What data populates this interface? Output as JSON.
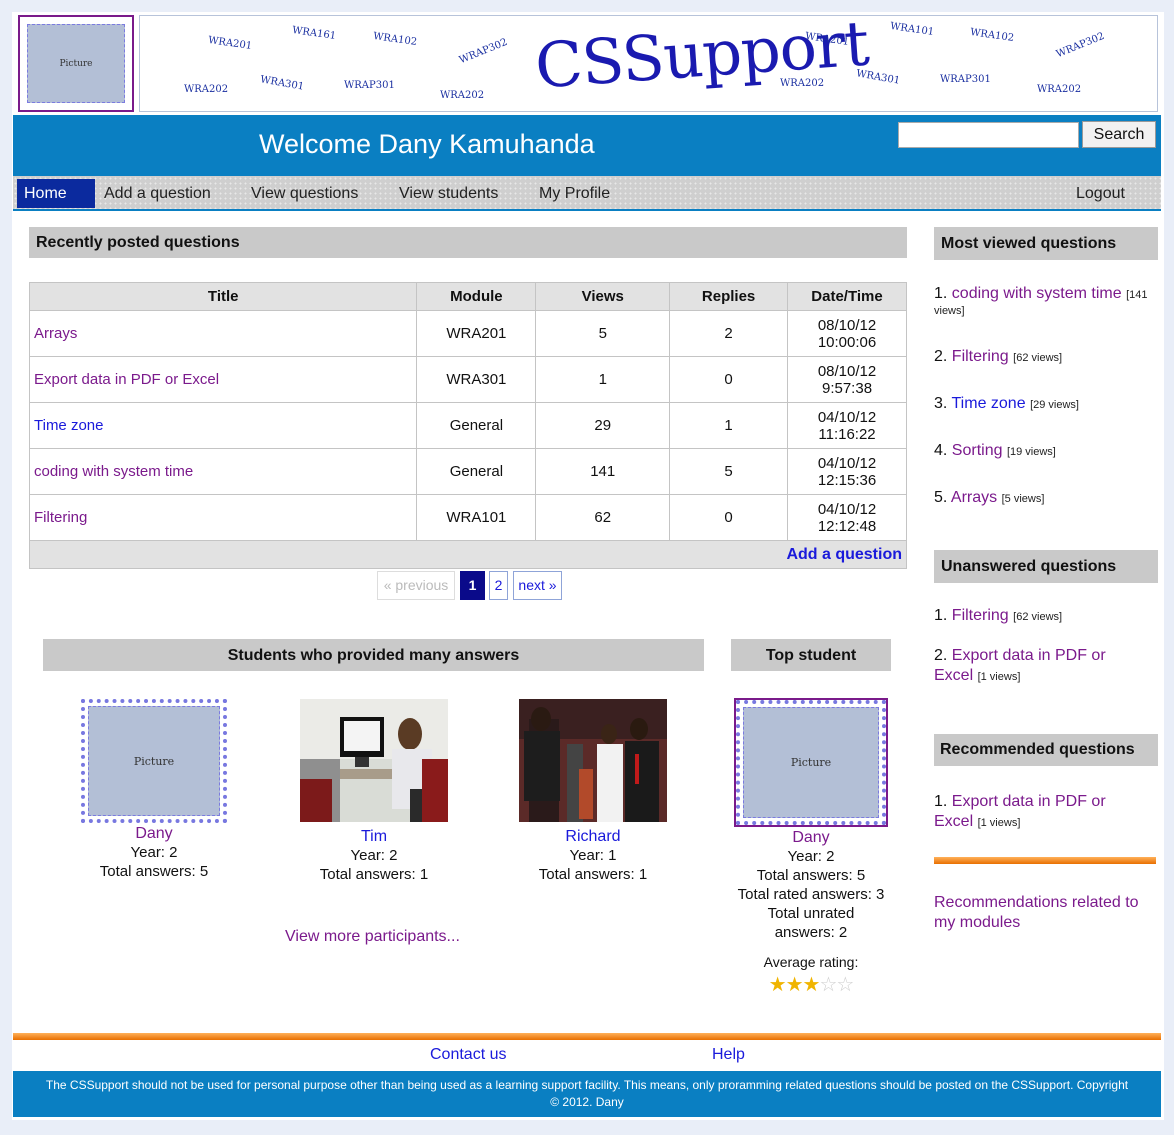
{
  "header": {
    "logo_placeholder": "Picture",
    "brand": "CSSupport",
    "banner_words": [
      "WRA201",
      "WRA161",
      "WRA102",
      "WRAP302",
      "WRA202",
      "WRA301",
      "WRAP301",
      "WRA202",
      "WRA201",
      "WRA101",
      "WRA102",
      "WRAP302",
      "WRA202",
      "WRA301",
      "WRAP301",
      "WRA202"
    ],
    "welcome": "Welcome Dany Kamuhanda",
    "search_button": "Search"
  },
  "nav": {
    "items": [
      "Home",
      "Add a question",
      "View questions",
      "View students",
      "My Profile"
    ],
    "logout": "Logout"
  },
  "recent": {
    "heading": "Recently posted questions",
    "columns": [
      "Title",
      "Module",
      "Views",
      "Replies",
      "Date/Time"
    ],
    "rows": [
      {
        "title": "Arrays",
        "module": "WRA201",
        "views": "5",
        "replies": "2",
        "date": "08/10/12",
        "time": "10:00:06"
      },
      {
        "title": "Export data in PDF or Excel",
        "module": "WRA301",
        "views": "1",
        "replies": "0",
        "date": "08/10/12",
        "time": "9:57:38"
      },
      {
        "title": "Time zone",
        "module": "General",
        "views": "29",
        "replies": "1",
        "date": "04/10/12",
        "time": "11:16:22"
      },
      {
        "title": "coding with system time",
        "module": "General",
        "views": "141",
        "replies": "5",
        "date": "04/10/12",
        "time": "12:15:36"
      },
      {
        "title": "Filtering",
        "module": "WRA101",
        "views": "62",
        "replies": "0",
        "date": "04/10/12",
        "time": "12:12:48"
      }
    ],
    "add_question": "Add a question",
    "pager": {
      "prev": "« previous",
      "p1": "1",
      "p2": "2",
      "next": "next »"
    }
  },
  "students": {
    "heading": "Students who provided many answers",
    "items": [
      {
        "name": "Dany",
        "year": "Year: 2",
        "answers": "Total answers: 5",
        "picture": "Picture"
      },
      {
        "name": "Tim",
        "year": "Year: 2",
        "answers": "Total answers: 1"
      },
      {
        "name": "Richard",
        "year": "Year: 1",
        "answers": "Total answers: 1"
      }
    ],
    "more": "View more participants..."
  },
  "top_student": {
    "heading": "Top student",
    "picture": "Picture",
    "name": "Dany",
    "year": "Year: 2",
    "answers": "Total answers: 5",
    "rated": "Total rated answers: 3",
    "unrated_1": "Total unrated",
    "unrated_2": "answers: 2",
    "rating_label": "Average rating:",
    "rating": 3,
    "rating_max": 5
  },
  "sidebar": {
    "most_viewed_heading": "Most viewed questions",
    "most_viewed": [
      {
        "num": "1.",
        "title": "coding with system time",
        "views": "[141"
      },
      {
        "num": "2.",
        "title": "Filtering",
        "views": "[62 views]"
      },
      {
        "num": "3.",
        "title": "Time zone",
        "views": "[29 views]"
      },
      {
        "num": "4.",
        "title": "Sorting",
        "views": "[19 views]"
      },
      {
        "num": "5.",
        "title": "Arrays",
        "views": "[5 views]"
      }
    ],
    "most_viewed_wrap": "views]",
    "unanswered_heading": "Unanswered questions",
    "unanswered": [
      {
        "num": "1.",
        "title": "Filtering",
        "views": "[62 views]"
      },
      {
        "num": "2.",
        "title": "Export data in PDF or",
        "title2": "Excel",
        "views": "[1 views]"
      }
    ],
    "recommended_heading": "Recommended questions",
    "recommended": [
      {
        "num": "1.",
        "title": "Export data in PDF or",
        "title2": "Excel",
        "views": "[1 views]"
      }
    ],
    "modules_link_1": "Recommendations related to",
    "modules_link_2": "my modules"
  },
  "footer": {
    "contact": "Contact us",
    "help": "Help",
    "notice": "The CSSupport should not be used for personal purpose other than being used as a learning support facility. This means, only proramming related questions should be posted on the CSSupport. Copyright © 2012. Dany"
  },
  "colors": {
    "brand_blue": "#0a7fc2",
    "nav_active": "#0b2a9e",
    "link": "#7b1a8c",
    "accent_orange": "#e86f00"
  }
}
